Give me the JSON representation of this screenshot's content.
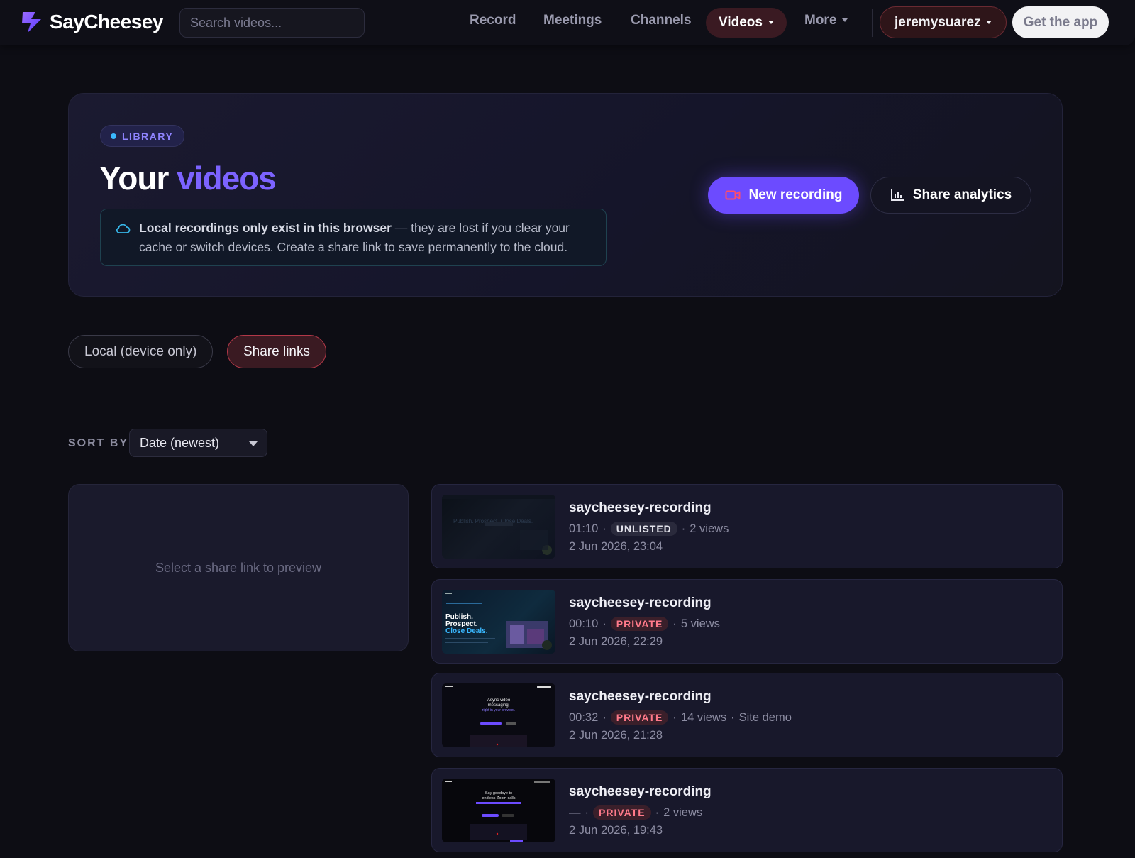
{
  "app": {
    "name": "SayCheesey"
  },
  "header": {
    "search_placeholder": "Search videos...",
    "nav": [
      {
        "label": "Record"
      },
      {
        "label": "Meetings"
      },
      {
        "label": "Channels"
      },
      {
        "label": "Videos",
        "active": true
      },
      {
        "label": "More"
      }
    ],
    "user": "jeremysuarez",
    "get_app": "Get the app"
  },
  "hero": {
    "badge": "LIBRARY",
    "title_plain": "Your ",
    "title_accent": "videos",
    "notice_bold": "Local recordings only exist in this browser",
    "notice_text": " — they are lost if you clear your cache or switch devices. Create a share link to save permanently to the cloud.",
    "new_recording": "New recording",
    "share_analytics": "Share analytics"
  },
  "filters": {
    "local": "Local (device only)",
    "share": "Share links",
    "active": "share"
  },
  "sort": {
    "label": "SORT BY",
    "value": "Date (newest)"
  },
  "preview": {
    "empty_text": "Select a share link to preview"
  },
  "videos": [
    {
      "title": "saycheesey-recording",
      "duration": "01:10",
      "visibility": "UNLISTED",
      "views": "2 views",
      "extra": "",
      "date": "2 Jun 2026, 23:04"
    },
    {
      "title": "saycheesey-recording",
      "duration": "00:10",
      "visibility": "PRIVATE",
      "views": "5 views",
      "extra": "",
      "date": "2 Jun 2026, 22:29"
    },
    {
      "title": "saycheesey-recording",
      "duration": "00:32",
      "visibility": "PRIVATE",
      "views": "14 views",
      "extra": "Site demo",
      "date": "2 Jun 2026, 21:28"
    },
    {
      "title": "saycheesey-recording",
      "duration": "—",
      "visibility": "PRIVATE",
      "views": "2 views",
      "extra": "",
      "date": "2 Jun 2026, 19:43"
    }
  ],
  "thumbnails": {
    "t1_headline": "Publish. Prospect. Close Deals.",
    "t2_headline_white": "Publish.\nProspect.",
    "t2_headline_accent": "Close Deals.",
    "t3_headline": "Async video messaging, right in your browser.",
    "t4_headline": "Say goodbye to endless Zoom calls"
  },
  "colors": {
    "accent": "#7c63ff",
    "brand_button": "#6c4bff",
    "danger": "#ff7a8a",
    "background": "#0d0d14"
  }
}
